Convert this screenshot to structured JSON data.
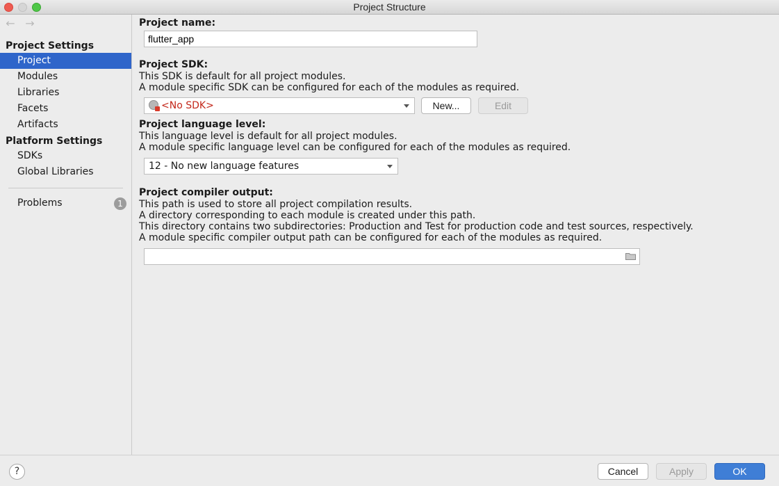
{
  "window": {
    "title": "Project Structure"
  },
  "nav": {
    "back_icon": "arrow-left-icon",
    "forward_icon": "arrow-right-icon"
  },
  "sidebar": {
    "project_settings_header": "Project Settings",
    "project_settings_items": [
      "Project",
      "Modules",
      "Libraries",
      "Facets",
      "Artifacts"
    ],
    "platform_settings_header": "Platform Settings",
    "platform_settings_items": [
      "SDKs",
      "Global Libraries"
    ],
    "problems_label": "Problems",
    "problems_count": "1",
    "selected_item": "Project"
  },
  "project_name": {
    "label": "Project name:",
    "value": "flutter_app"
  },
  "project_sdk": {
    "label": "Project SDK:",
    "desc1": "This SDK is default for all project modules.",
    "desc2": "A module specific SDK can be configured for each of the modules as required.",
    "selected": "<No SDK>",
    "new_button": "New...",
    "edit_button": "Edit"
  },
  "language_level": {
    "label": "Project language level:",
    "desc1": "This language level is default for all project modules.",
    "desc2": "A module specific language level can be configured for each of the modules as required.",
    "selected": "12 - No new language features"
  },
  "compiler_output": {
    "label": "Project compiler output:",
    "desc1": "This path is used to store all project compilation results.",
    "desc2": "A directory corresponding to each module is created under this path.",
    "desc3": "This directory contains two subdirectories: Production and Test for production code and test sources, respectively.",
    "desc4": "A module specific compiler output path can be configured for each of the modules as required.",
    "value": ""
  },
  "footer": {
    "help": "?",
    "cancel": "Cancel",
    "apply": "Apply",
    "ok": "OK"
  },
  "colors": {
    "selection": "#2f65ca",
    "ok_button": "#3f7ed6",
    "no_sdk_text": "#c3271a"
  }
}
